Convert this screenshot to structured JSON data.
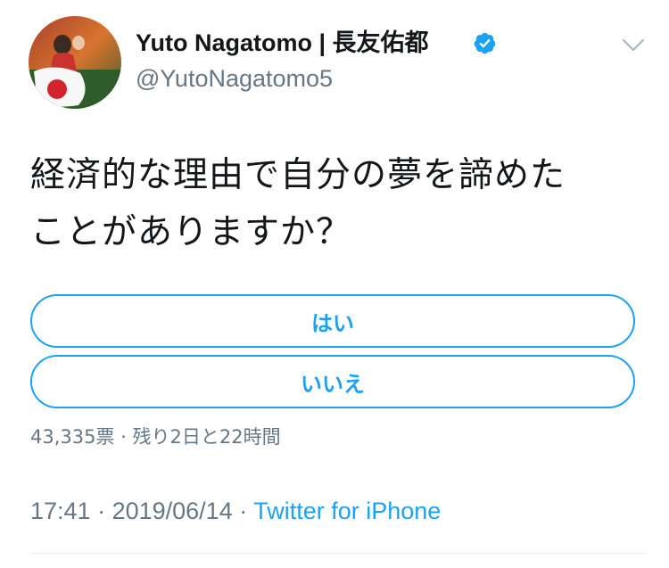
{
  "user": {
    "display_name": "Yuto Nagatomo | 長友佑都",
    "handle": "@YutoNagatomo5",
    "verified": true
  },
  "tweet": {
    "text_line1": "経済的な理由で自分の夢を諦めた",
    "text_line2": "ことがありますか？"
  },
  "poll": {
    "options": [
      {
        "label": "はい"
      },
      {
        "label": "いいえ"
      }
    ],
    "meta": "43,335票 · 残り2日と22時間"
  },
  "footer": {
    "time": "17:41",
    "separator": " · ",
    "date": "2019/06/14",
    "source": "Twitter for iPhone"
  },
  "colors": {
    "accent": "#1da1f2",
    "secondary_text": "#657786",
    "primary_text": "#14171a",
    "divider": "#e6ecf0"
  },
  "icons": {
    "verified": "verified-badge-icon",
    "menu": "chevron-down-icon"
  }
}
